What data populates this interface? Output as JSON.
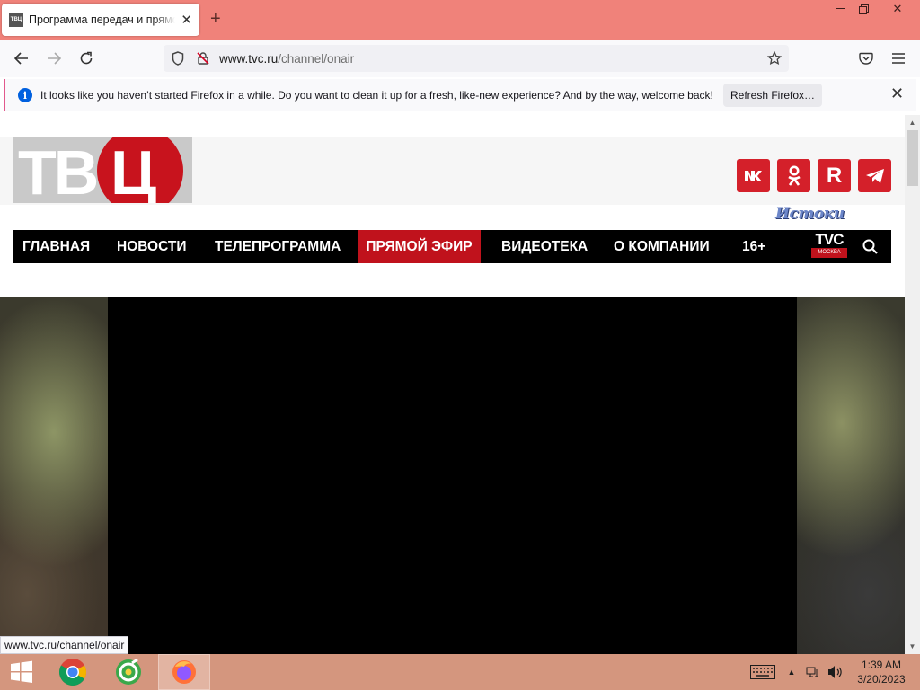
{
  "browser": {
    "tab": {
      "title": "Программа передач и прямой эфир",
      "favicon_text": "ТВЦ"
    },
    "window_controls": [
      "minimize",
      "restore",
      "close"
    ],
    "url": {
      "domain": "www.tvc.ru",
      "path": "/channel/onair"
    },
    "notification": {
      "message": "It looks like you haven’t started Firefox in a while. Do you want to clean it up for a fresh, like-new experience? And by the way, welcome back!",
      "button_label": "Refresh Firefox…"
    },
    "status_url": "www.tvc.ru/channel/onair"
  },
  "site": {
    "logo_text": "ТВЦ",
    "social": [
      {
        "name": "vk",
        "glyph": "vk"
      },
      {
        "name": "odnoklassniki",
        "glyph": "ok"
      },
      {
        "name": "rutube",
        "glyph": "R"
      },
      {
        "name": "telegram",
        "glyph": "tg"
      }
    ],
    "istoki_label": "Истоки",
    "menu": [
      {
        "label": "ГЛАВНАЯ",
        "active": false
      },
      {
        "label": "НОВОСТИ",
        "active": false
      },
      {
        "label": "ТЕЛЕПРОГРАММА",
        "active": false
      },
      {
        "label": "ПРЯМОЙ ЭФИР",
        "active": true
      },
      {
        "label": "ВИДЕОТЕКА",
        "active": false
      },
      {
        "label": "О КОМПАНИИ",
        "active": false
      },
      {
        "label": "16+",
        "active": false
      }
    ],
    "tvc_logo": {
      "top": "TVC",
      "bottom": "МОСКВА"
    },
    "colors": {
      "brand_red": "#d4202a",
      "menu_bg": "#000000",
      "active_menu": "#c0121c"
    }
  },
  "taskbar": {
    "apps": [
      "start",
      "chrome",
      "360-browser",
      "firefox"
    ],
    "active_app": "firefox",
    "clock": {
      "time": "1:39 AM",
      "date": "3/20/2023"
    }
  }
}
